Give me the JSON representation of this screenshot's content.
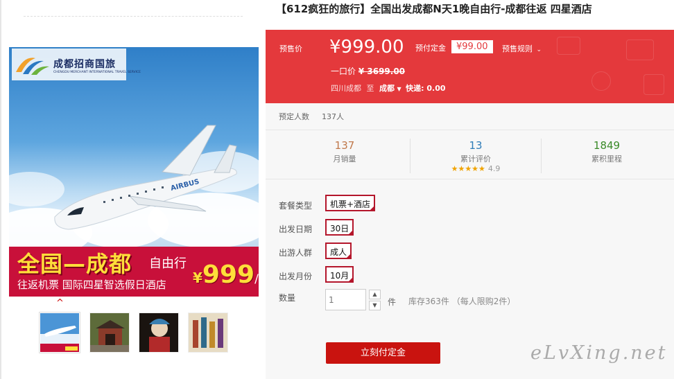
{
  "product": {
    "title": "【612疯狂的旅行】全国出发成都N天1晚自由行-成都往返 四星酒店"
  },
  "image": {
    "logo_cn": "成都招商国旅",
    "logo_en": "CHENGDU MERCHANT INTERNATIONAL TRAVEL SERVICE",
    "promo_title": "全国—成都",
    "promo_free": "自由行",
    "promo_sub": "往返机票 国际四星智选假日酒店",
    "promo_yen": "¥",
    "promo_price": "999",
    "promo_unit": "/人",
    "plane_text": "AIRBUS"
  },
  "thumb_caret": "^",
  "price": {
    "presale_label": "预售价",
    "amount": "¥999.00",
    "deposit_label": "预付定金",
    "deposit_value": "¥99.00",
    "rules_label": "预售规则",
    "one_price_label": "一口价",
    "one_price_value": "¥ 3699.00",
    "route_from": "四川成都",
    "route_to_label": "至",
    "route_to": "成都",
    "shipping": "快递: 0.00"
  },
  "booked": {
    "label": "预定人数",
    "value": "137人"
  },
  "stats": {
    "monthly_sales": {
      "value": "137",
      "label": "月销量",
      "color": "#c0784b"
    },
    "reviews": {
      "value": "13",
      "label": "累计评价",
      "color": "#2f7db8",
      "stars": "★★★★★",
      "score": "4.9"
    },
    "points": {
      "value": "1849",
      "label": "累积里程",
      "color": "#3a8a28"
    }
  },
  "options": {
    "package": {
      "label": "套餐类型",
      "value": "机票+酒店"
    },
    "date": {
      "label": "出发日期",
      "value": "30日"
    },
    "group": {
      "label": "出游人群",
      "value": "成人"
    },
    "month": {
      "label": "出发月份",
      "value": "10月"
    }
  },
  "quantity": {
    "label": "数量",
    "value": "1",
    "unit": "件",
    "stock": "库存363件 （每人限购2件）"
  },
  "pay_button": "立刻付定金",
  "watermark": "eLvXing.net"
}
